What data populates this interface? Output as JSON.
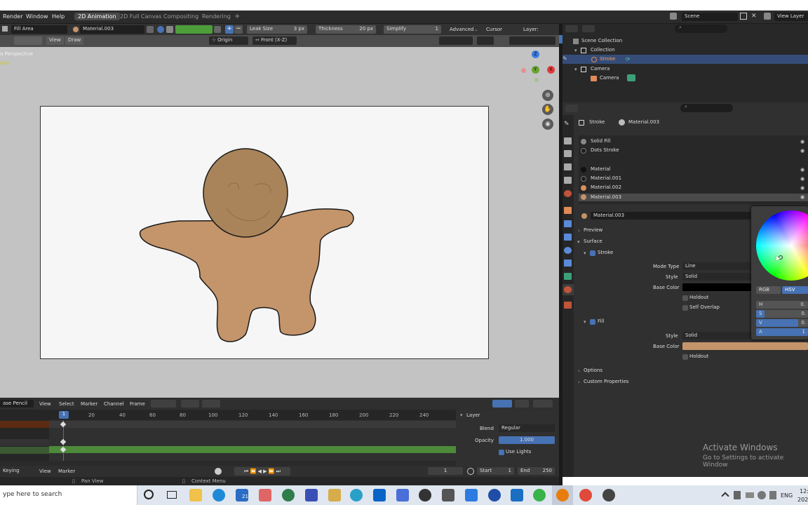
{
  "menubar": {
    "items": [
      "Render",
      "Window",
      "Help"
    ],
    "workspaces": [
      "2D Animation",
      "2D Full Canvas",
      "Compositing",
      "Rendering"
    ],
    "add_tab": "+",
    "scene": "Scene",
    "view_layer": "View Layer"
  },
  "toolbar": {
    "fill_area": "Fill Area",
    "material": "Material.003",
    "leak_size_label": "Leak Size",
    "leak_size_value": "3 px",
    "thickness_label": "Thickness",
    "thickness_value": "20 px",
    "simplify_label": "Simplify",
    "simplify_value": "1",
    "advanced": "Advanced",
    "cursor": "Cursor",
    "layer": "Layer:"
  },
  "viewport_header": {
    "view": "View",
    "draw": "Draw",
    "origin": "Origin",
    "orientation": "Front (X-Z)"
  },
  "viewport": {
    "perspective_label": "a Perspective",
    "mode_label": "ode",
    "axis": {
      "x": "X",
      "y": "Y",
      "z": "Z"
    }
  },
  "timeline": {
    "mode": "ase Pencil",
    "menus": [
      "View",
      "Select",
      "Marker",
      "Channel",
      "Frame"
    ],
    "current_frame_marker": "1",
    "ticks": [
      "20",
      "40",
      "60",
      "80",
      "100",
      "120",
      "140",
      "160",
      "180",
      "200",
      "220",
      "240"
    ],
    "layer_panel": {
      "title": "Layer",
      "blend_label": "Blend",
      "blend_value": "Regular",
      "opacity_label": "Opacity",
      "opacity_value": "1.000",
      "use_lights": "Use Lights"
    },
    "footer": {
      "keying": "Keying",
      "view": "View",
      "marker": "Marker",
      "frame": "1",
      "start_label": "Start",
      "start_value": "1",
      "end_label": "End",
      "end_value": "250"
    }
  },
  "statusbar": {
    "pan_view": "Pan View",
    "context_menu": "Context Menu"
  },
  "outliner": {
    "items": [
      "Scene Collection",
      "Collection",
      "Stroke",
      "Camera",
      "Camera"
    ]
  },
  "properties": {
    "breadcrumb_object": "Stroke",
    "breadcrumb_material": "Material.003",
    "slots": [
      "Solid Fill",
      "Dots Stroke",
      "Material",
      "Material.001",
      "Material.002",
      "Material.003"
    ],
    "material_name": "Material.003",
    "sections": {
      "preview": "Preview",
      "surface": "Surface",
      "stroke": "Stroke",
      "fill": "Fill",
      "options": "Options",
      "custom_properties": "Custom Properties"
    },
    "stroke": {
      "mode_type_label": "Mode Type",
      "mode_type_value": "Line",
      "style_label": "Style",
      "style_value": "Solid",
      "base_color_label": "Base Color",
      "holdout": "Holdout",
      "self_overlap": "Self Overlap"
    },
    "fill": {
      "style_label": "Style",
      "style_value": "Solid",
      "base_color_label": "Base Color",
      "holdout": "Holdout"
    }
  },
  "colorpicker": {
    "rgb": "RGB",
    "hsv": "HSV",
    "h_label": "H",
    "h_value": "0.",
    "s_label": "S",
    "s_value": "0.",
    "v_label": "V",
    "v_value": "0.",
    "a_label": "A",
    "a_value": "1"
  },
  "watermark": {
    "title": "Activate Windows",
    "subtitle": "Go to Settings to activate Window"
  },
  "taskbar": {
    "search_placeholder": "ype here to search",
    "mail_badge": "21",
    "lang": "ENG",
    "time": "12:",
    "date": "202"
  },
  "colors": {
    "cookie_body": "#c4946a",
    "cookie_head": "#a9845a",
    "active_blue": "#4772b3",
    "green_track": "#4d8a3a"
  }
}
